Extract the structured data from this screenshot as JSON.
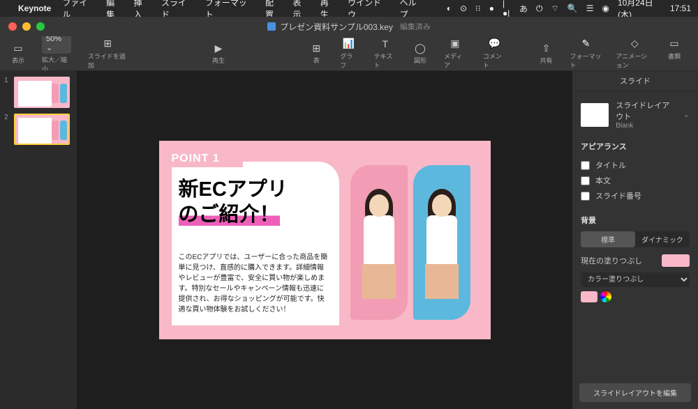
{
  "menubar": {
    "app": "Keynote",
    "items": [
      "ファイル",
      "編集",
      "挿入",
      "スライド",
      "フォーマット",
      "配置",
      "表示",
      "再生",
      "ウインドウ",
      "ヘルプ"
    ],
    "right": {
      "date": "10月24日(木)",
      "time": "17:51"
    }
  },
  "titlebar": {
    "filename": "プレゼン資料サンプル003.key",
    "edited": "編集済み"
  },
  "toolbar": {
    "view": "表示",
    "zoom": "50% ⌄",
    "zoom_label": "拡大／縮小",
    "add_slide": "スライドを追加",
    "play": "再生",
    "table": "表",
    "chart": "グラフ",
    "text": "テキスト",
    "shape": "図形",
    "media": "メディア",
    "comment": "コメント",
    "share": "共有",
    "format": "フォーマット",
    "animate": "アニメーション",
    "document": "書類"
  },
  "navigator": {
    "slides": [
      "1",
      "2"
    ]
  },
  "slide": {
    "point": "POINT 1",
    "title_l1": "新ECアプリ",
    "title_l2": "のご紹介！",
    "body": "このECアプリでは、ユーザーに合った商品を簡単に見つけ、直感的に購入できます。詳細情報やレビューが豊富で、安全に買い物が楽しめます。特別なセールやキャンペーン情報も迅速に提供され、お得なショッピングが可能です。快適な買い物体験をお試しください！"
  },
  "inspector": {
    "tabs": {
      "format": "フォーマット",
      "animate": "アニメーション",
      "document": "書類"
    },
    "subtab": "スライド",
    "layout_label": "スライドレイアウト",
    "layout_name": "Blank",
    "appearance": "アピアランス",
    "checks": {
      "title": "タイトル",
      "body": "本文",
      "slideno": "スライド番号"
    },
    "background": "背景",
    "seg": {
      "standard": "標準",
      "dynamic": "ダイナミック"
    },
    "fill_label": "現在の塗りつぶし",
    "fill_type": "カラー塗りつぶし",
    "edit_layout": "スライドレイアウトを編集"
  }
}
